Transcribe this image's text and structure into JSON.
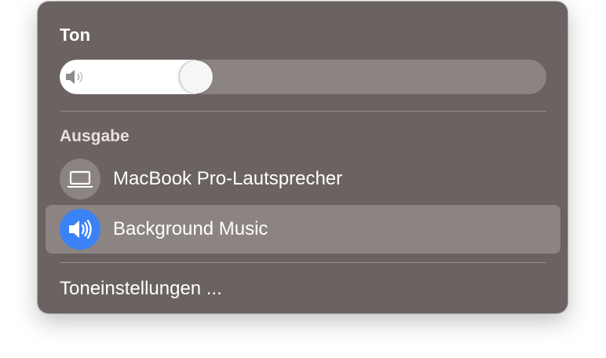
{
  "sound": {
    "title": "Ton",
    "volume_percent": 28
  },
  "output": {
    "heading": "Ausgabe",
    "devices": [
      {
        "label": "MacBook Pro-Lautsprecher",
        "icon": "laptop-icon",
        "selected": false,
        "icon_bg": "#8c8483"
      },
      {
        "label": "Background Music",
        "icon": "speaker-icon",
        "selected": true,
        "icon_bg": "#3a82f6"
      }
    ]
  },
  "footer": {
    "settings_label": "Toneinstellungen ..."
  },
  "colors": {
    "panel": "#6b6361",
    "track": "#8c8483",
    "accent": "#3a82f6"
  }
}
